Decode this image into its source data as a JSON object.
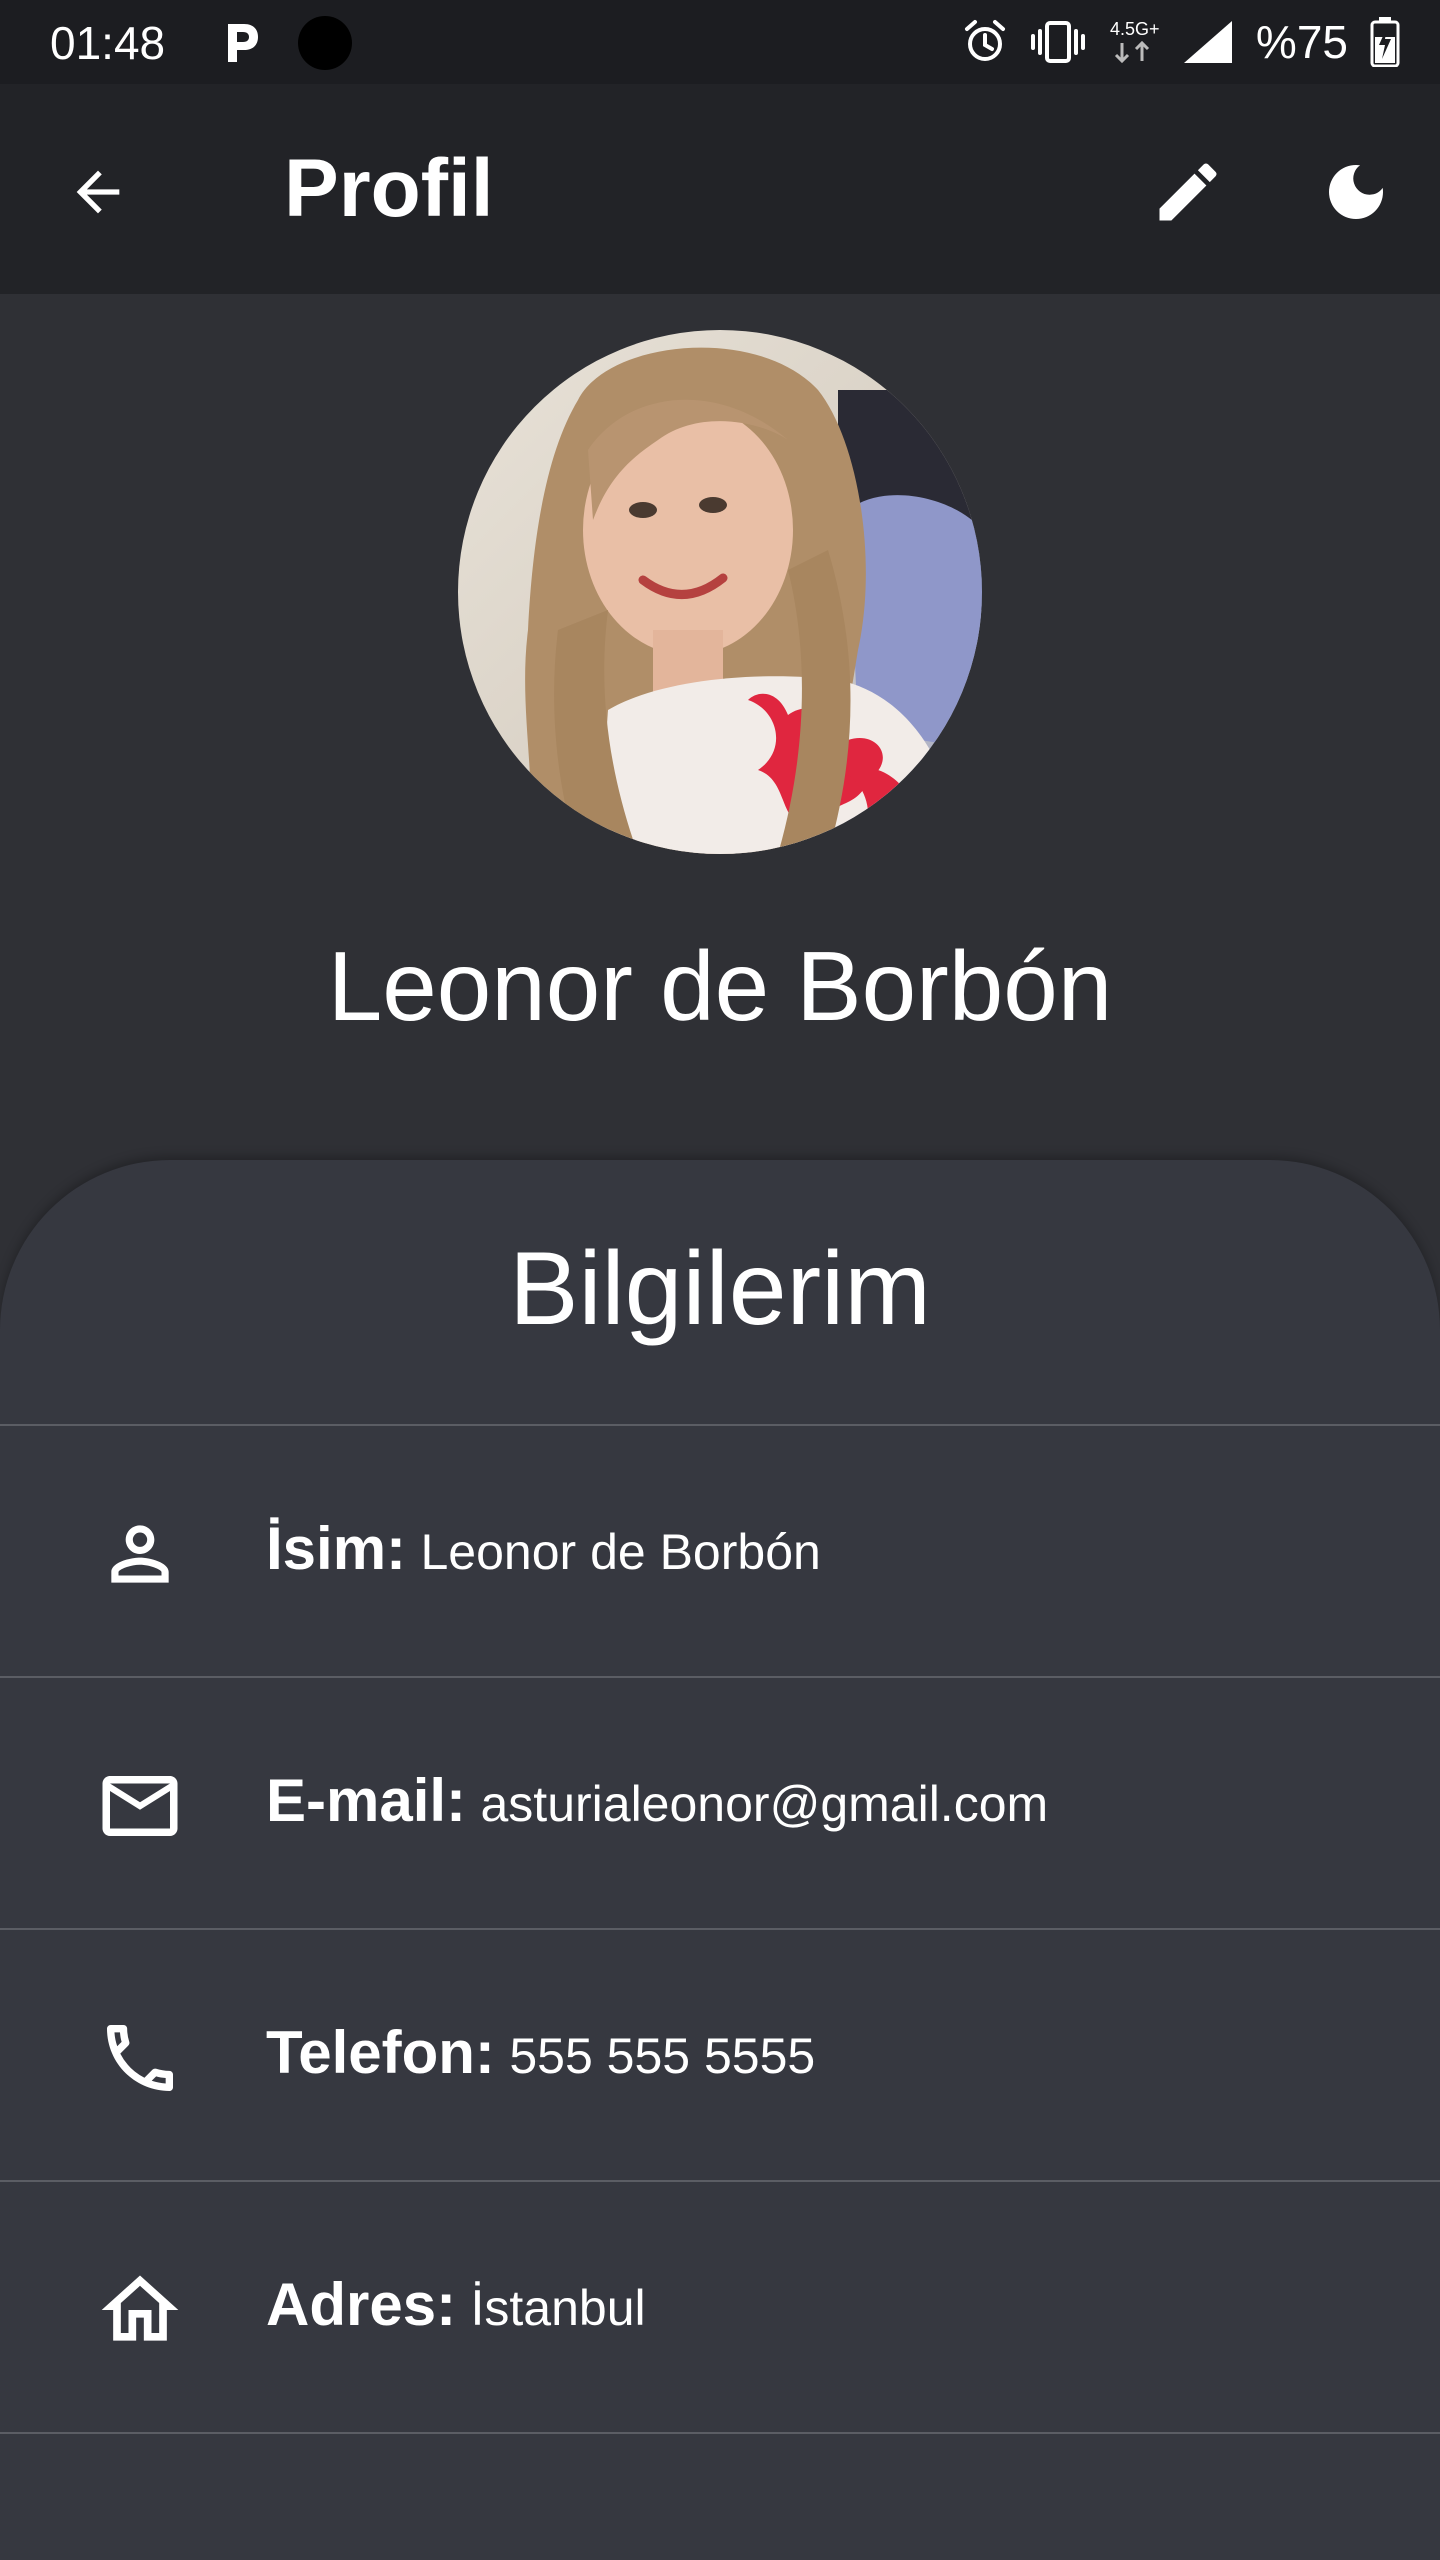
{
  "status_bar": {
    "time": "01:48",
    "network": "4.5G+",
    "battery": "%75",
    "icons": [
      "p-app-icon",
      "camera-dot-icon",
      "alarm-icon",
      "vibrate-icon",
      "network-icon",
      "signal-icon",
      "battery-charging-icon"
    ]
  },
  "app_bar": {
    "title": "Profil",
    "icons": [
      "back-arrow-icon",
      "edit-pencil-icon",
      "moon-icon"
    ]
  },
  "profile": {
    "name": "Leonor de Borbón"
  },
  "info": {
    "title": "Bilgilerim",
    "rows": [
      {
        "icon": "person-icon",
        "label": "İsim:",
        "value": "Leonor de Borbón"
      },
      {
        "icon": "mail-icon",
        "label": "E-mail:",
        "value": "asturialeonor@gmail.com"
      },
      {
        "icon": "phone-icon",
        "label": "Telefon:",
        "value": "555 555 5555"
      },
      {
        "icon": "home-icon",
        "label": "Adres:",
        "value": "İstanbul"
      }
    ]
  },
  "colors": {
    "background": "#2f3035",
    "status_bar": "#1c1d21",
    "app_bar": "#222327",
    "card": "#363840",
    "divider": "#5b5d64",
    "text": "#ffffff"
  }
}
